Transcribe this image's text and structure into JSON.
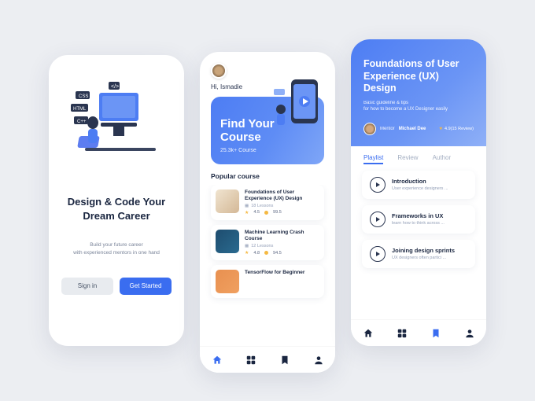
{
  "onboarding": {
    "title": "Design & Code Your Dream Career",
    "subtitle": "Build your future career\nwith experienced mentors in one hand",
    "sign_in": "Sign in",
    "get_started": "Get Started"
  },
  "home": {
    "greeting": "Hi, Ismadie",
    "hero_title": "Find Your Course",
    "hero_count": "25.3k+ Course",
    "section": "Popular course",
    "courses": [
      {
        "title": "Foundations of User Experience (UX) Design",
        "lessons": "18 Lessons",
        "rating": "4.5",
        "coins": "99.5"
      },
      {
        "title": "Machine Learning Crash Course",
        "lessons": "12 Lessons",
        "rating": "4.8",
        "coins": "94.5"
      },
      {
        "title": "TensorFlow  for Beginner",
        "lessons": "",
        "rating": "",
        "coins": ""
      }
    ],
    "nav": [
      "home",
      "grid",
      "bookmark",
      "profile"
    ]
  },
  "detail": {
    "title": "Foundations of User Experience (UX) Design",
    "subtitle": "Basic guideline & tips\nfor how to become a UX Designer easily",
    "mentor_label": "Mentor",
    "mentor_name": "Michael Dee",
    "rating": "4.9(15 Review)",
    "tabs": [
      "Playlist",
      "Review",
      "Author"
    ],
    "playlist": [
      {
        "title": "Introduction",
        "desc": "User experience designers ..."
      },
      {
        "title": "Frameworks in UX",
        "desc": "learn how to think across ..."
      },
      {
        "title": "Joining design sprints",
        "desc": "UX designers often partici ..."
      }
    ],
    "nav": [
      "home",
      "grid",
      "bookmark",
      "profile"
    ]
  }
}
